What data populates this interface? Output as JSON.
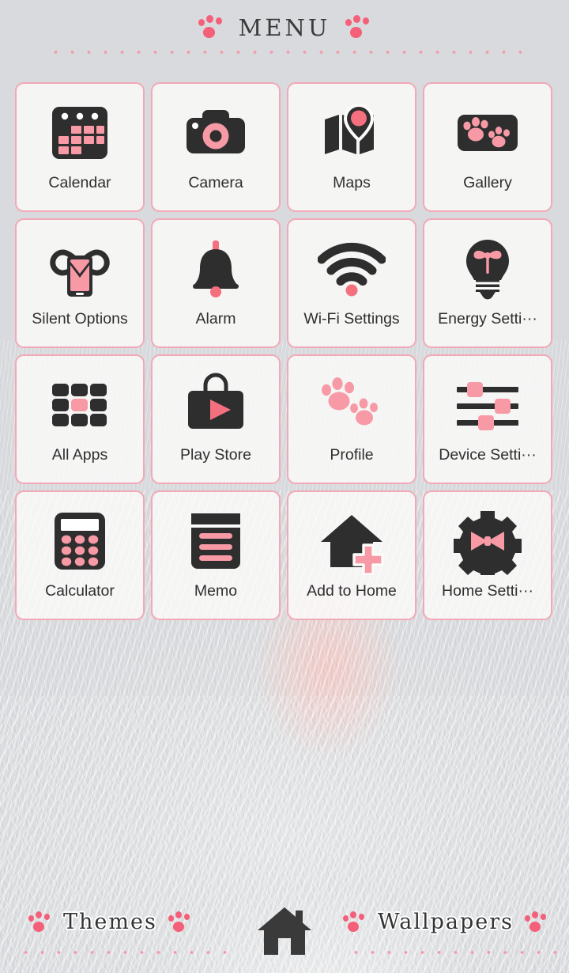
{
  "header": {
    "title": "MENU",
    "left_paw_icon": "paw-print-icon",
    "right_paw_icon": "paw-print-icon",
    "divider": "dotted-divider"
  },
  "theme": {
    "accent_pink": "#f4607a",
    "soft_pink": "#f79aa6",
    "border_pink": "#f1a9b6",
    "dark": "#2e2e2e",
    "tile_bg": "#fcfbfa",
    "page_bg": "#f0efec"
  },
  "grid": {
    "columns": 4,
    "rows": 4,
    "apps": [
      {
        "label": "Calendar",
        "icon": "calendar-icon"
      },
      {
        "label": "Camera",
        "icon": "camera-icon"
      },
      {
        "label": "Maps",
        "icon": "maps-icon"
      },
      {
        "label": "Gallery",
        "icon": "gallery-icon"
      },
      {
        "label": "Silent Options",
        "icon": "silent-options-icon"
      },
      {
        "label": "Alarm",
        "icon": "alarm-bell-icon"
      },
      {
        "label": "Wi-Fi Settings",
        "icon": "wifi-icon"
      },
      {
        "label": "Energy Setti···",
        "icon": "lightbulb-icon"
      },
      {
        "label": "All Apps",
        "icon": "all-apps-grid-icon"
      },
      {
        "label": "Play Store",
        "icon": "play-store-icon"
      },
      {
        "label": "Profile",
        "icon": "paw-prints-icon"
      },
      {
        "label": "Device Setti···",
        "icon": "sliders-icon"
      },
      {
        "label": "Calculator",
        "icon": "calculator-icon"
      },
      {
        "label": "Memo",
        "icon": "memo-icon"
      },
      {
        "label": "Add to Home",
        "icon": "add-to-home-icon"
      },
      {
        "label": "Home Setti···",
        "icon": "gear-bow-icon"
      }
    ]
  },
  "bottom_bar": {
    "themes_label": "Themes",
    "wallpapers_label": "Wallpapers",
    "home_icon": "home-icon",
    "paw_icon": "paw-print-icon"
  }
}
